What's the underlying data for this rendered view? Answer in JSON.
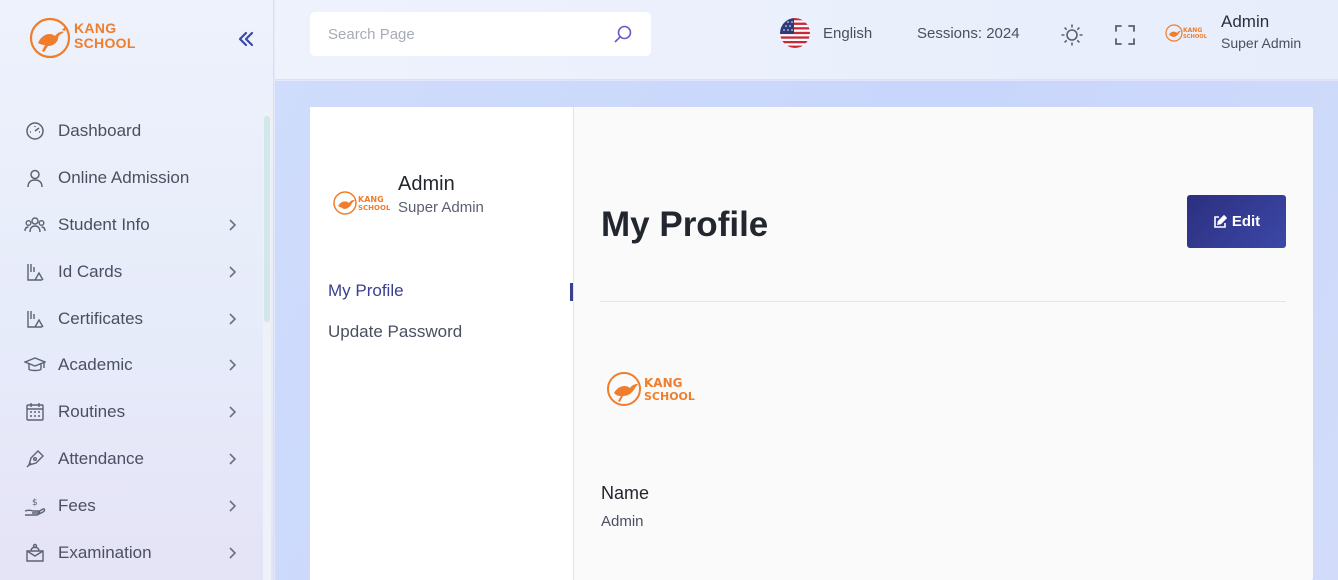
{
  "brand": {
    "line1": "KANG",
    "line2": "SCHOOL",
    "color": "#ef7d2c"
  },
  "sidebar": {
    "items": [
      {
        "label": "Dashboard",
        "icon": "dashboard-icon",
        "has_children": false
      },
      {
        "label": "Online Admission",
        "icon": "user-icon",
        "has_children": false
      },
      {
        "label": "Student Info",
        "icon": "users-icon",
        "has_children": true
      },
      {
        "label": "Id Cards",
        "icon": "id-card-icon",
        "has_children": true
      },
      {
        "label": "Certificates",
        "icon": "certificate-icon",
        "has_children": true
      },
      {
        "label": "Academic",
        "icon": "graduation-cap-icon",
        "has_children": true
      },
      {
        "label": "Routines",
        "icon": "calendar-icon",
        "has_children": true
      },
      {
        "label": "Attendance",
        "icon": "pen-icon",
        "has_children": true
      },
      {
        "label": "Fees",
        "icon": "money-hand-icon",
        "has_children": true
      },
      {
        "label": "Examination",
        "icon": "exam-icon",
        "has_children": true
      }
    ]
  },
  "topbar": {
    "search_placeholder": "Search Page",
    "language": "English",
    "sessions": "Sessions: 2024",
    "user_name": "Admin",
    "user_role": "Super Admin"
  },
  "profile_nav": {
    "user_name": "Admin",
    "user_role": "Super Admin",
    "links": [
      "My Profile",
      "Update Password"
    ]
  },
  "profile": {
    "title": "My Profile",
    "edit_label": "Edit",
    "name_label": "Name",
    "name_value": "Admin"
  },
  "colors": {
    "accent": "#3a3f8f",
    "button": "#2f3a92",
    "logo": "#ef7d2c"
  }
}
